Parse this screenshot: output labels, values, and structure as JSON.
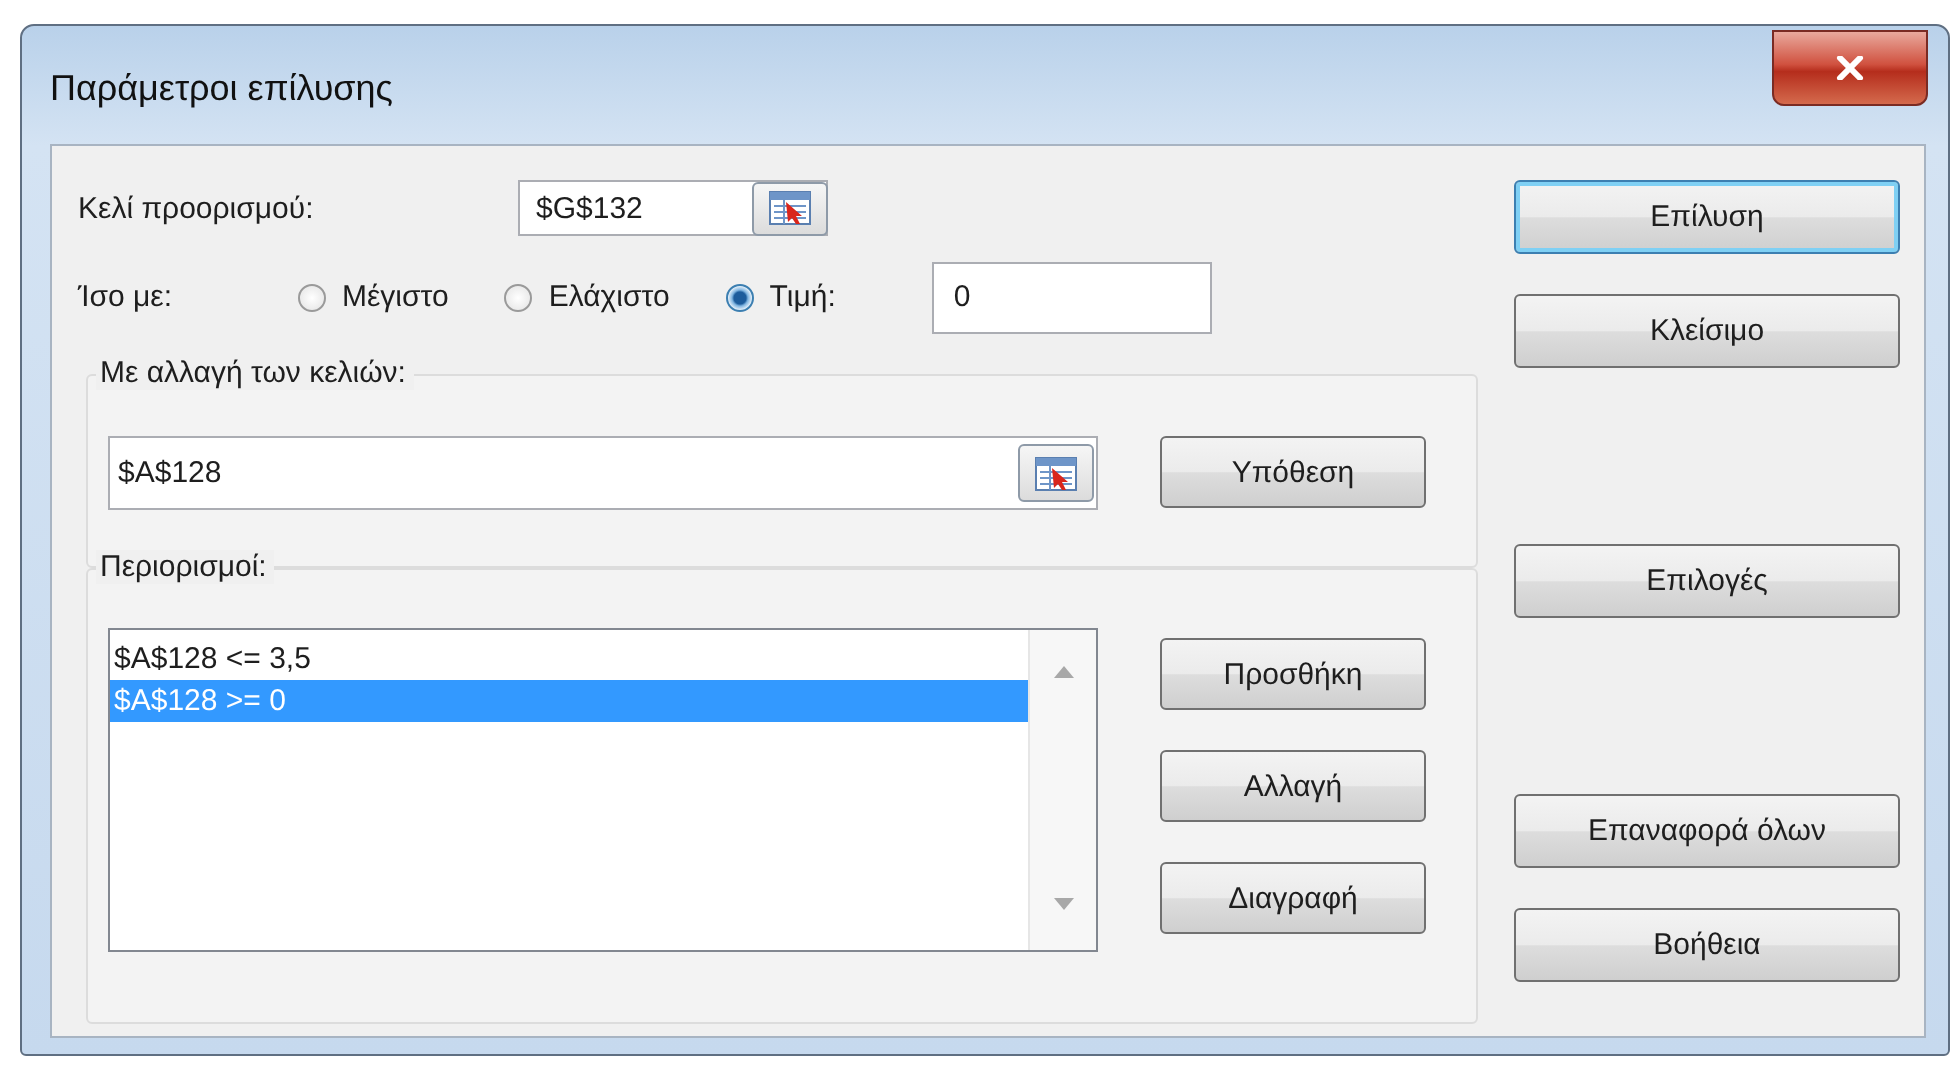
{
  "window": {
    "title": "Παράμετροι επίλυσης"
  },
  "target_cell": {
    "label": "Κελί προορισμού:",
    "value": "$G$132"
  },
  "equal_to": {
    "label": "Ίσο με:",
    "value": "0",
    "options": [
      {
        "label": "Μέγιστο",
        "selected": false
      },
      {
        "label": "Ελάχιστο",
        "selected": false
      },
      {
        "label": "Τιμή:",
        "selected": true
      }
    ]
  },
  "changing_cells": {
    "label": "Με αλλαγή των κελιών:",
    "value": "$A$128",
    "button": "Υπόθεση"
  },
  "constraints": {
    "label": "Περιορισμοί:",
    "items": [
      {
        "text": "$A$128 <= 3,5",
        "selected": false
      },
      {
        "text": "$A$128 >= 0",
        "selected": true
      }
    ],
    "buttons": [
      "Προσθήκη",
      "Αλλαγή",
      "Διαγραφή"
    ]
  },
  "side_buttons": [
    [
      {
        "label": "Επίλυση",
        "default": true
      },
      {
        "label": "Κλείσιμο",
        "default": false
      }
    ],
    [
      {
        "label": "Επιλογές",
        "default": false
      }
    ],
    [
      {
        "label": "Επαναφορά όλων",
        "default": false
      },
      {
        "label": "Βοήθεια",
        "default": false
      }
    ]
  ]
}
